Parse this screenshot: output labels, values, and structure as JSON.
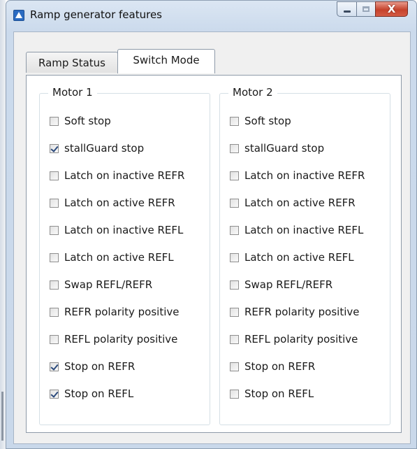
{
  "window": {
    "title": "Ramp generator features",
    "close_glyph": "X"
  },
  "tabs": [
    {
      "label": "Ramp Status",
      "active": false
    },
    {
      "label": "Switch Mode",
      "active": true
    }
  ],
  "groups": [
    {
      "title": "Motor 1",
      "options": [
        {
          "label": "Soft stop",
          "checked": false
        },
        {
          "label": "stallGuard stop",
          "checked": true
        },
        {
          "label": "Latch on inactive REFR",
          "checked": false
        },
        {
          "label": "Latch on active REFR",
          "checked": false
        },
        {
          "label": "Latch on inactive REFL",
          "checked": false
        },
        {
          "label": "Latch on active REFL",
          "checked": false
        },
        {
          "label": "Swap REFL/REFR",
          "checked": false
        },
        {
          "label": "REFR polarity positive",
          "checked": false
        },
        {
          "label": "REFL polarity positive",
          "checked": false
        },
        {
          "label": "Stop on REFR",
          "checked": true
        },
        {
          "label": "Stop on REFL",
          "checked": true
        }
      ]
    },
    {
      "title": "Motor 2",
      "options": [
        {
          "label": "Soft stop",
          "checked": false
        },
        {
          "label": "stallGuard stop",
          "checked": false
        },
        {
          "label": "Latch on inactive REFR",
          "checked": false
        },
        {
          "label": "Latch on active REFR",
          "checked": false
        },
        {
          "label": "Latch on inactive REFL",
          "checked": false
        },
        {
          "label": "Latch on active REFL",
          "checked": false
        },
        {
          "label": "Swap REFL/REFR",
          "checked": false
        },
        {
          "label": "REFR polarity positive",
          "checked": false
        },
        {
          "label": "REFL polarity positive",
          "checked": false
        },
        {
          "label": "Stop on REFR",
          "checked": false
        },
        {
          "label": "Stop on REFL",
          "checked": false
        }
      ]
    }
  ]
}
